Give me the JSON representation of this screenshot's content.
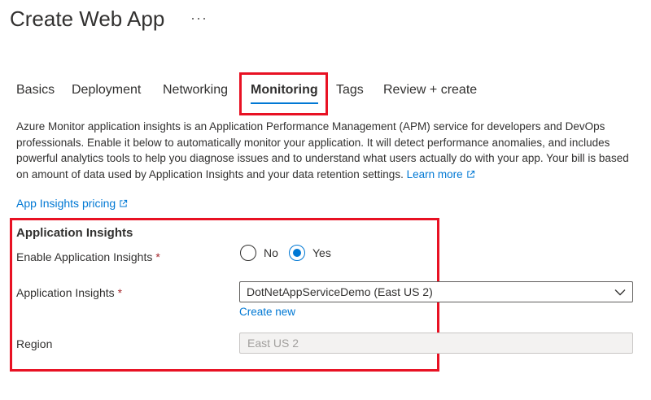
{
  "page": {
    "title": "Create Web App",
    "more": "···"
  },
  "tabs": [
    {
      "label": "Basics",
      "active": false
    },
    {
      "label": "Deployment",
      "active": false
    },
    {
      "label": "Networking",
      "active": false
    },
    {
      "label": "Monitoring",
      "active": true
    },
    {
      "label": "Tags",
      "active": false
    },
    {
      "label": "Review + create",
      "active": false
    }
  ],
  "description": {
    "text": "Azure Monitor application insights is an Application Performance Management (APM) service for developers and DevOps professionals. Enable it below to automatically monitor your application. It will detect performance anomalies, and includes powerful analytics tools to help you diagnose issues and to understand what users actually do with your app. Your bill is based on amount of data used by Application Insights and your data retention settings.",
    "learn_more": "Learn more"
  },
  "pricing_link": "App Insights pricing",
  "section": {
    "title": "Application Insights",
    "enable_label": "Enable Application Insights",
    "required_mark": "*",
    "radio_no": "No",
    "radio_yes": "Yes",
    "selected": "Yes",
    "insights_label": "Application Insights",
    "insights_value": "DotNetAppServiceDemo (East US 2)",
    "create_new": "Create new",
    "region_label": "Region",
    "region_value": "East US 2"
  },
  "colors": {
    "accent": "#0078d4",
    "annotation": "#e81123",
    "required": "#a4262c"
  },
  "icons": {
    "more": "ellipsis-icon",
    "external": "external-link-icon",
    "dropdown": "chevron-down-icon"
  }
}
